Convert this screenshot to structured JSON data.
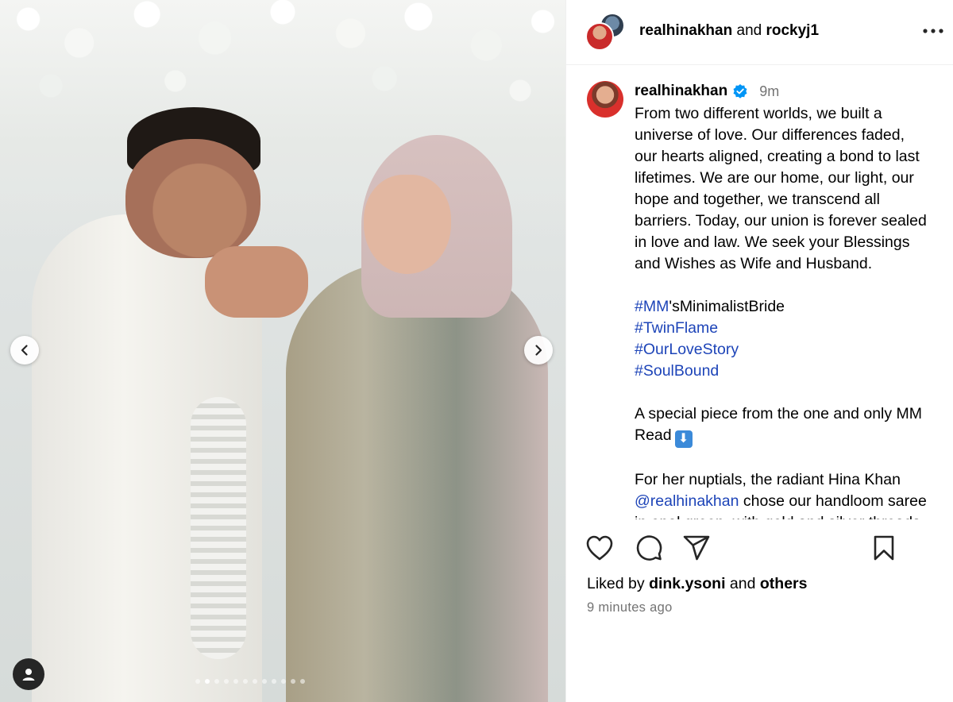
{
  "header": {
    "primary_user": "realhinakhan",
    "joiner": "and",
    "collaborator": "rockyj1"
  },
  "caption": {
    "username": "realhinakhan",
    "time": "9m",
    "lines": [
      "From two different worlds, we built a",
      "universe of love. Our differences faded,",
      "our hearts aligned, creating a bond to last",
      "lifetimes. We are our home, our light, our",
      "hope and together, we transcend all",
      "barriers. Today, our union is forever sealed",
      "in love and law. We seek your Blessings",
      "and Wishes as Wife and Husband."
    ],
    "hashtag1_tag": "#MM",
    "hashtag1_rest": "'sMinimalistBride",
    "hashtag2": "#TwinFlame",
    "hashtag3": "#OurLoveStory",
    "hashtag4": "#SoulBound",
    "special_line1": "A special piece from the one and only MM",
    "special_line2": "Read",
    "special_emoji": "⬇",
    "nuptials_line1": "For her nuptials, the radiant Hina Khan",
    "nuptials_mention": "@realhinakhan",
    "nuptials_line2_rest": " chose our handloom saree",
    "nuptials_line3": "in opal green, with gold and silver threads"
  },
  "likes": {
    "prefix": "Liked by",
    "user": "dink.ysoni",
    "joiner": "and",
    "others": "others"
  },
  "timestamp": "9 minutes ago",
  "carousel": {
    "total_slides": 12,
    "active_slide": 2
  },
  "icons": {
    "more": "more-horizontal-icon",
    "verified": "verified-badge-icon",
    "like": "heart-icon",
    "comment": "comment-icon",
    "share": "paper-plane-icon",
    "save": "bookmark-icon",
    "prev": "chevron-left-icon",
    "next": "chevron-right-icon",
    "tags": "user-tag-icon"
  },
  "colors": {
    "link": "#1d44b8",
    "verified": "#0095f6",
    "muted": "#737373"
  }
}
